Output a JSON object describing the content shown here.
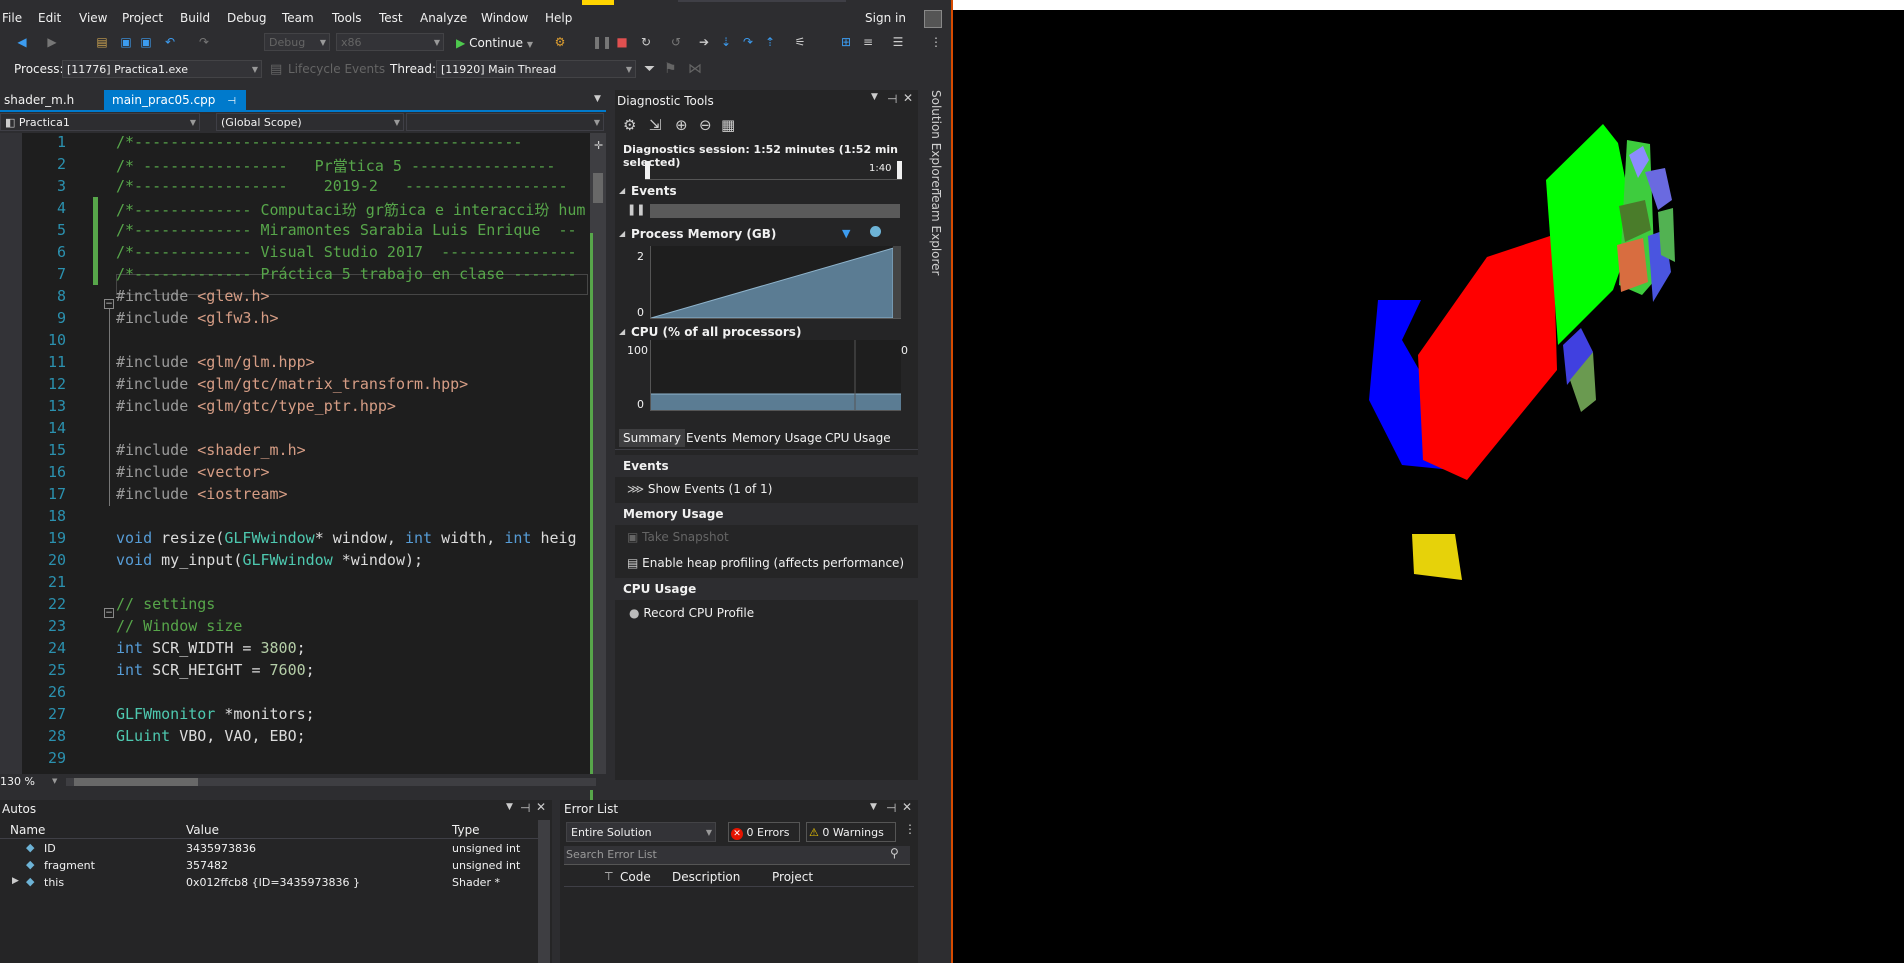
{
  "menubar": {
    "items": [
      "File",
      "Edit",
      "View",
      "Project",
      "Build",
      "Debug",
      "Team",
      "Tools",
      "Test",
      "Analyze",
      "Window",
      "Help"
    ],
    "sign_in": "Sign in"
  },
  "toolbar": {
    "config": "Debug",
    "platform": "x86",
    "continue_label": "Continue"
  },
  "debug_location": {
    "process_label": "Process:",
    "process_value": "[11776] Practica1.exe",
    "lifecycle_label": "Lifecycle Events",
    "thread_label": "Thread:",
    "thread_value": "[11920] Main Thread"
  },
  "editor": {
    "tabs": [
      "shader_m.h",
      "main_prac05.cpp"
    ],
    "project": "Practica1",
    "scope": "(Global Scope)",
    "zoom": "130 %",
    "line_numbers": [
      "1",
      "2",
      "3",
      "4",
      "5",
      "6",
      "7",
      "8",
      "9",
      "10",
      "11",
      "12",
      "13",
      "14",
      "15",
      "16",
      "17",
      "18",
      "19",
      "20",
      "21",
      "22",
      "23",
      "24",
      "25",
      "26",
      "27",
      "28",
      "29"
    ],
    "lines": [
      "/*-------------------------------------------",
      "/* ----------------   Pr當tica 5 ----------------",
      "/*-----------------    2019-2   ------------------",
      "/*------------- Computaci玢 gr筋ica e interacci玢 hum",
      "/*------------- Miramontes Sarabia Luis Enrique  --",
      "/*------------- Visual Studio 2017  ---------------",
      "/*------------- Práctica 5 trabajo en clase -------",
      "#include <glew.h>",
      "#include <glfw3.h>",
      "",
      "#include <glm/glm.hpp>",
      "#include <glm/gtc/matrix_transform.hpp>",
      "#include <glm/gtc/type_ptr.hpp>",
      "",
      "#include <shader_m.h>",
      "#include <vector>",
      "#include <iostream>",
      "",
      "void resize(GLFWwindow* window, int width, int heig",
      "void my_input(GLFWwindow *window);",
      "",
      "// settings",
      "// Window size",
      "int SCR_WIDTH = 3800;",
      "int SCR_HEIGHT = 7600;",
      "",
      "GLFWmonitor *monitors;",
      "GLuint VBO, VAO, EBO;",
      ""
    ]
  },
  "diagnostic_tools": {
    "title": "Diagnostic Tools",
    "session": "Diagnostics session: 1:52 minutes (1:52 min selected)",
    "timeline_tick": "1:40",
    "events_label": "Events",
    "memory_label": "Process Memory (GB)",
    "memory_max": "2",
    "memory_min": "0",
    "cpu_label": "CPU (% of all processors)",
    "cpu_max": "100",
    "cpu_min": "0",
    "memory_growth_fraction": 0.97,
    "tabs": [
      "Summary",
      "Events",
      "Memory Usage",
      "CPU Usage"
    ],
    "events_header": "Events",
    "show_events": "Show Events (1 of 1)",
    "memory_header": "Memory Usage",
    "take_snapshot": "Take Snapshot",
    "heap_profiling": "Enable heap profiling (affects performance)",
    "cpu_header": "CPU Usage",
    "record_cpu": "Record CPU Profile"
  },
  "autos": {
    "title": "Autos",
    "columns": [
      "Name",
      "Value",
      "Type"
    ],
    "rows": [
      {
        "name": "ID",
        "value": "3435973836",
        "type": "unsigned int"
      },
      {
        "name": "fragment",
        "value": "357482",
        "type": "unsigned int"
      },
      {
        "name": "this",
        "value": "0x012ffcb8 {ID=3435973836 }",
        "type": "Shader *"
      }
    ]
  },
  "error_list": {
    "title": "Error List",
    "scope": "Entire Solution",
    "errors": "0 Errors",
    "warnings": "0 Warnings",
    "search_placeholder": "Search Error List",
    "columns": [
      "Code",
      "Description",
      "Project"
    ]
  },
  "side_tabs": [
    "Solution Explorer",
    "Team Explorer"
  ],
  "colors": {
    "accent_tab": "#007acc",
    "red": "#ff0000",
    "green": "#00ff00",
    "blue": "#0000ff",
    "yellow": "#e6d20a"
  }
}
